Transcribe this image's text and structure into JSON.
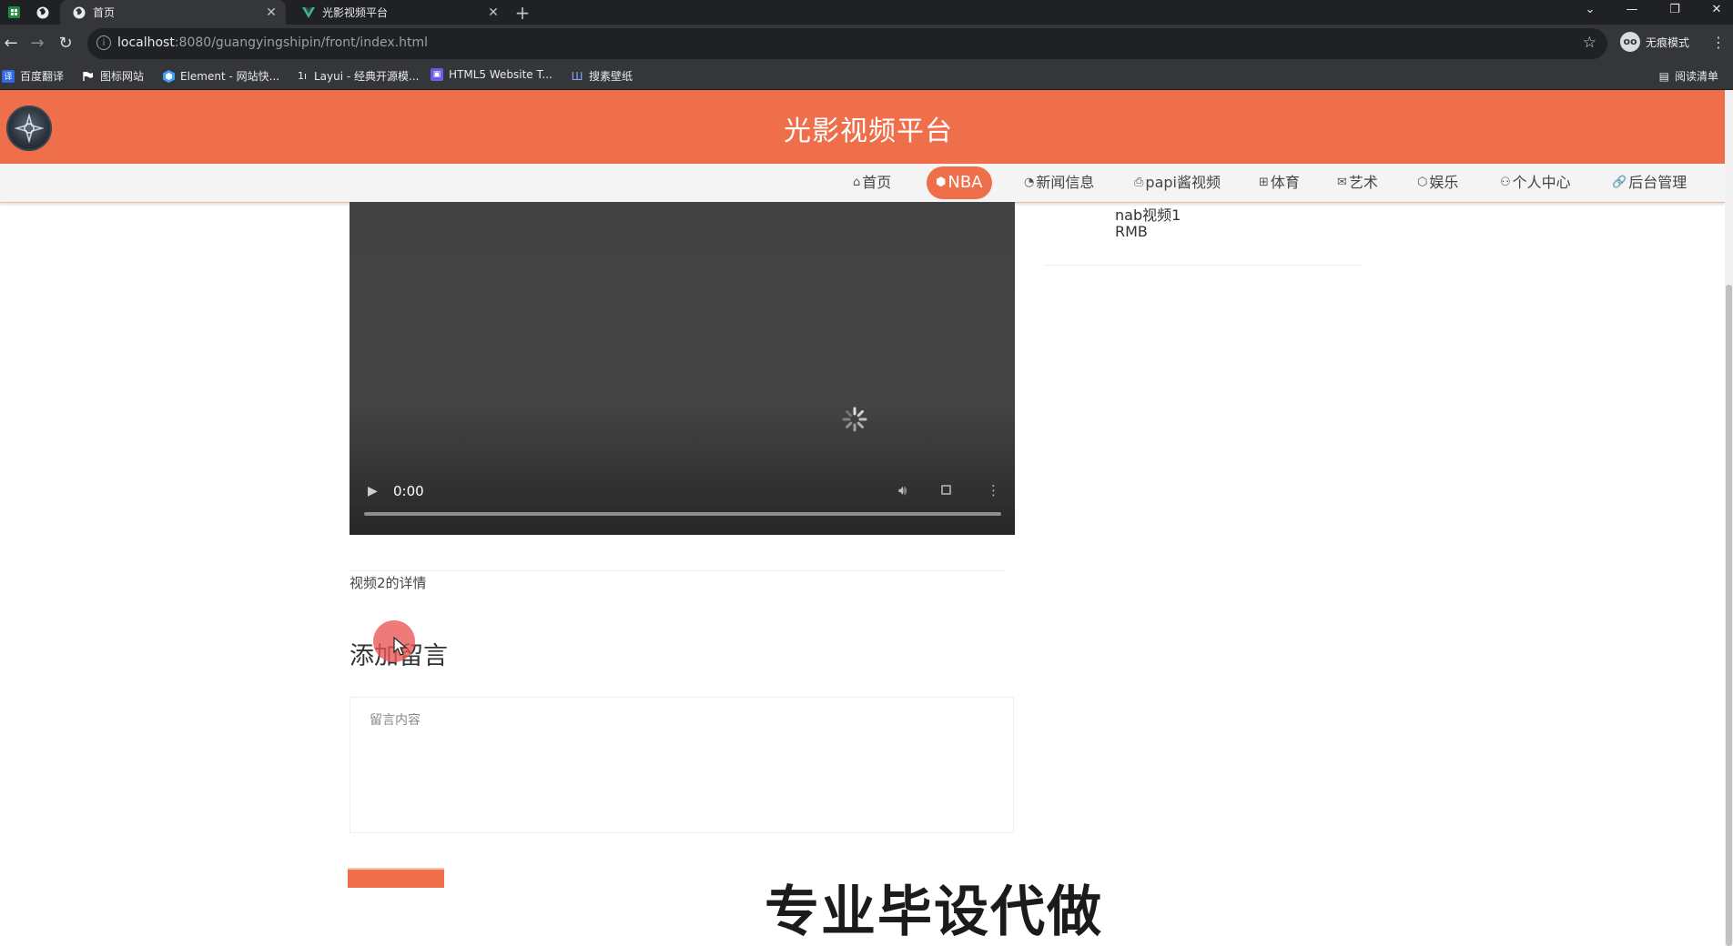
{
  "browser": {
    "tabs": [
      {
        "label": "首页",
        "active": true
      },
      {
        "label": "光影视频平台",
        "active": false
      }
    ],
    "url_host": "localhost",
    "url_path": ":8080/guangyingshipin/front/index.html",
    "incognito_label": "无痕模式",
    "bookmarks": [
      "百度翻译",
      "图标网站",
      "Element - 网站快...",
      "Layui - 经典开源模...",
      "HTML5 Website T...",
      "搜素壁纸"
    ],
    "reading_list": "阅读清单"
  },
  "site": {
    "title": "光影视频平台",
    "accent": "#ef6f4b",
    "nav": [
      {
        "label": "首页",
        "icon": "home-icon",
        "active": false
      },
      {
        "label": "NBA",
        "icon": "cube-icon",
        "active": true
      },
      {
        "label": "新闻信息",
        "icon": "gauge-icon",
        "active": false
      },
      {
        "label": "papi酱视频",
        "icon": "printer-icon",
        "active": false
      },
      {
        "label": "体育",
        "icon": "gift-icon",
        "active": false
      },
      {
        "label": "艺术",
        "icon": "mail-icon",
        "active": false
      },
      {
        "label": "娱乐",
        "icon": "box-icon",
        "active": false
      },
      {
        "label": "个人中心",
        "icon": "user-icon",
        "active": false
      },
      {
        "label": "后台管理",
        "icon": "link-icon",
        "active": false
      }
    ]
  },
  "video": {
    "time": "0:00",
    "progress": 0
  },
  "sidebar": {
    "name": "nab视频1",
    "price": "RMB"
  },
  "detail": {
    "text": "视频2的详情"
  },
  "comment": {
    "title": "添加留言",
    "placeholder": "留言内容"
  },
  "overlay": {
    "watermark": "专业毕设代做"
  }
}
